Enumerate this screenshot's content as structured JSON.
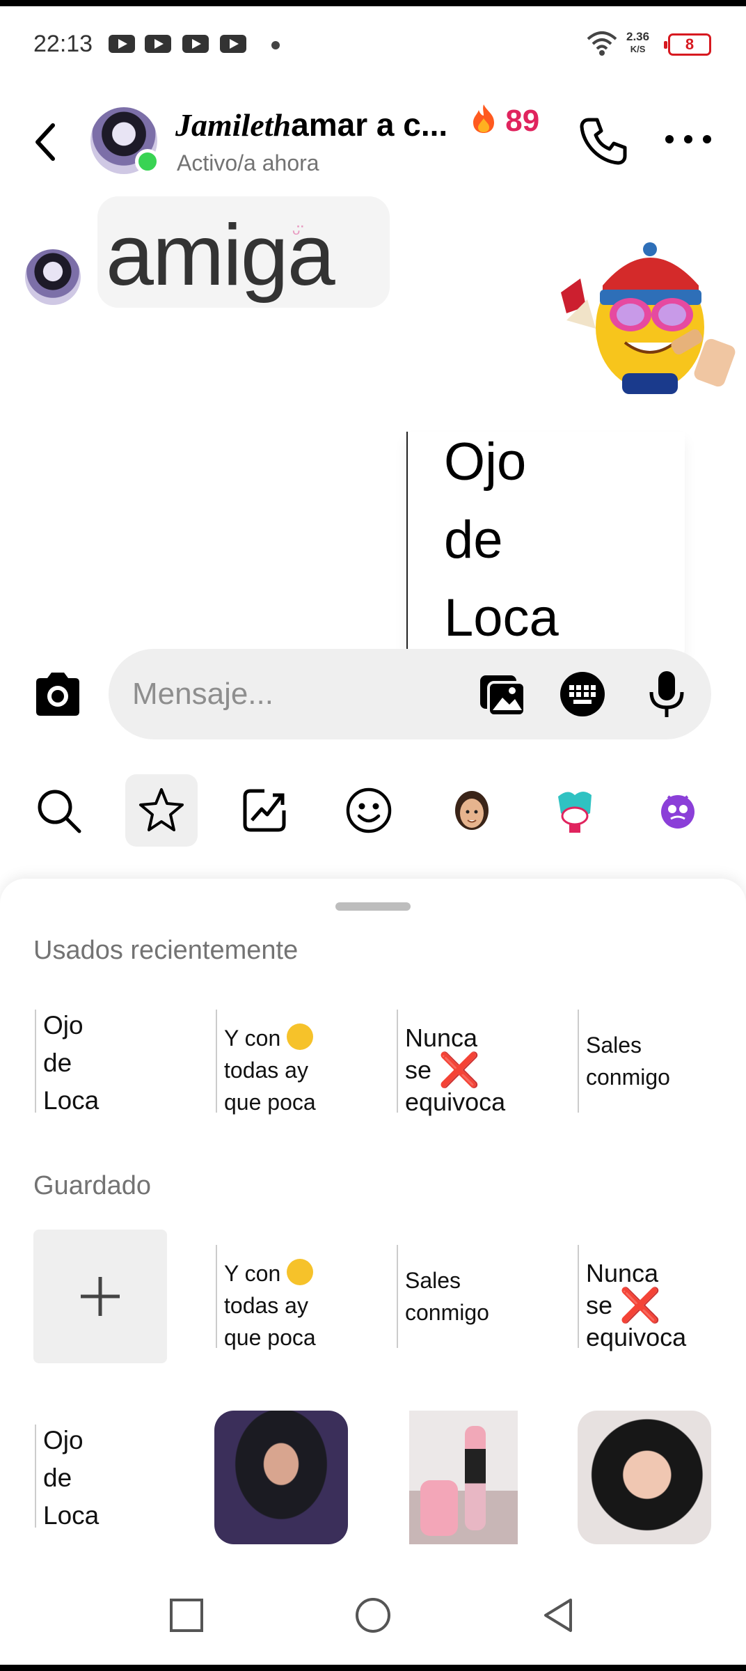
{
  "status_bar": {
    "time": "22:13",
    "net_speed_value": "2.36",
    "net_speed_unit": "K/S",
    "battery": "8"
  },
  "header": {
    "name_italic": "Jamileth",
    "name_rest": "amar a c...",
    "streak_icon": "fire-icon",
    "streak_count": "89",
    "presence": "Activo/a ahora"
  },
  "chat": {
    "received_sticker_text": "amiga",
    "sent_sticker_lines": [
      "Ojo",
      "de",
      "Loca"
    ]
  },
  "composer": {
    "placeholder": "Mensaje..."
  },
  "tabs": [
    {
      "icon": "search-icon"
    },
    {
      "icon": "star-icon",
      "active": true
    },
    {
      "icon": "trending-icon"
    },
    {
      "icon": "emoji-icon"
    },
    {
      "icon": "avatar-sticker-icon"
    },
    {
      "icon": "character-sticker-icon"
    },
    {
      "icon": "purple-face-sticker-icon"
    }
  ],
  "panel": {
    "recent_title": "Usados recientemente",
    "recent": [
      {
        "lines": [
          "Ojo",
          "de",
          "Loca"
        ]
      },
      {
        "line1": "Y con",
        "line2": "todas ay",
        "line3": "que poca"
      },
      {
        "line1": "Nunca",
        "line2": "se",
        "line3": "equivoca"
      },
      {
        "line1": "Sales",
        "line2": "conmigo"
      }
    ],
    "saved_title": "Guardado",
    "saved": [
      {
        "line1": "Y con",
        "line2": "todas ay",
        "line3": "que poca"
      },
      {
        "line1": "Sales",
        "line2": "conmigo"
      },
      {
        "line1": "Nunca",
        "line2": "se",
        "line3": "equivoca"
      },
      {
        "lines": [
          "Ojo",
          "de",
          "Loca"
        ]
      }
    ],
    "x_mark": "❌"
  },
  "colors": {
    "accent_red": "#d71920",
    "streak_pink": "#e0245e",
    "online_green": "#39d353",
    "muted_text": "#737373"
  }
}
